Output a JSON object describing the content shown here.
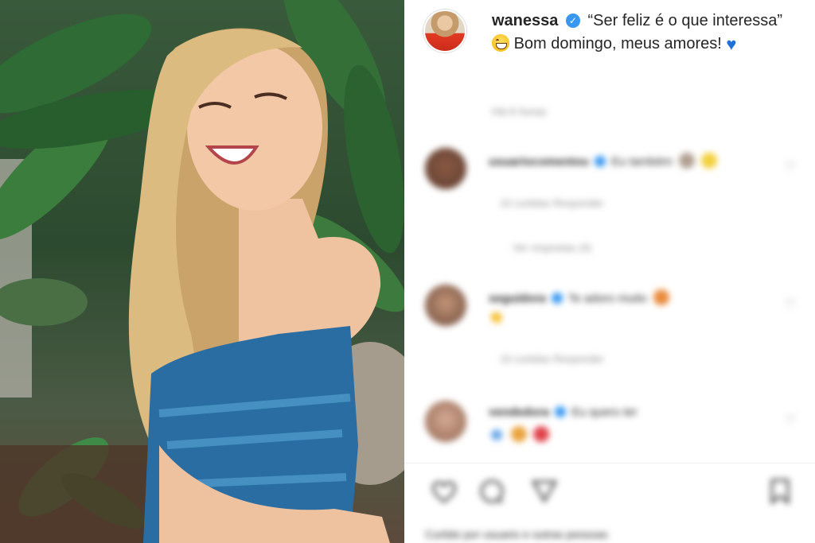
{
  "post": {
    "username": "wanessa",
    "caption": "“Ser feliz é o que interessa”",
    "caption_tail": "Bom domingo, meus amores!",
    "time_ago": "Há 6 horas",
    "icons": {
      "verified": "verified-badge-icon",
      "emoji1": "grinning-face-emoji",
      "emoji2": "blue-heart-emoji"
    }
  },
  "comments": [
    {
      "user": "usuariocomentou",
      "text": "Eu também",
      "meta": "10 curtidas   Responder",
      "replies": "Ver respostas (4)"
    },
    {
      "user": "seguidora",
      "text": "Te adoro muito",
      "extra": "👏",
      "meta": "10 curtidas   Responder"
    },
    {
      "user": "vendedora",
      "text": "Eu quero ter",
      "meta": ""
    }
  ],
  "actions": {
    "like": "heart-outline-icon",
    "comment": "comment-icon",
    "share": "send-icon",
    "save": "bookmark-icon"
  },
  "likes_line": "Curtido por usuario e outras pessoas",
  "colors": {
    "verified": "#3897f0",
    "text": "#262626",
    "muted": "#8e8e8e",
    "heart": "#1e6fd9"
  }
}
